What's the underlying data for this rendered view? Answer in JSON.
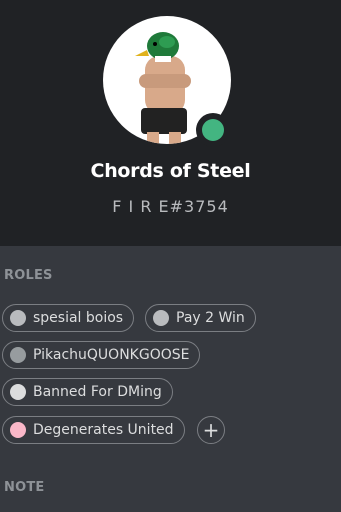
{
  "profile": {
    "username": "Chords of Steel",
    "discriminator": "F I R E#3754",
    "status_color": "#43b581"
  },
  "sections": {
    "roles_label": "ROLES",
    "note_label": "NOTE"
  },
  "roles": [
    {
      "name": "spesial boios",
      "color": "#b9bbbe"
    },
    {
      "name": "Pay 2 Win",
      "color": "#b9bbbe"
    },
    {
      "name": "PikachuQUONKGOOSE",
      "color": "#979c9f"
    },
    {
      "name": "Banned For DMing",
      "color": "#dcddde"
    },
    {
      "name": "Degenerates United",
      "color": "#f9b7c8"
    }
  ],
  "add_role_icon": "plus-icon",
  "add_role_symbol": "+"
}
